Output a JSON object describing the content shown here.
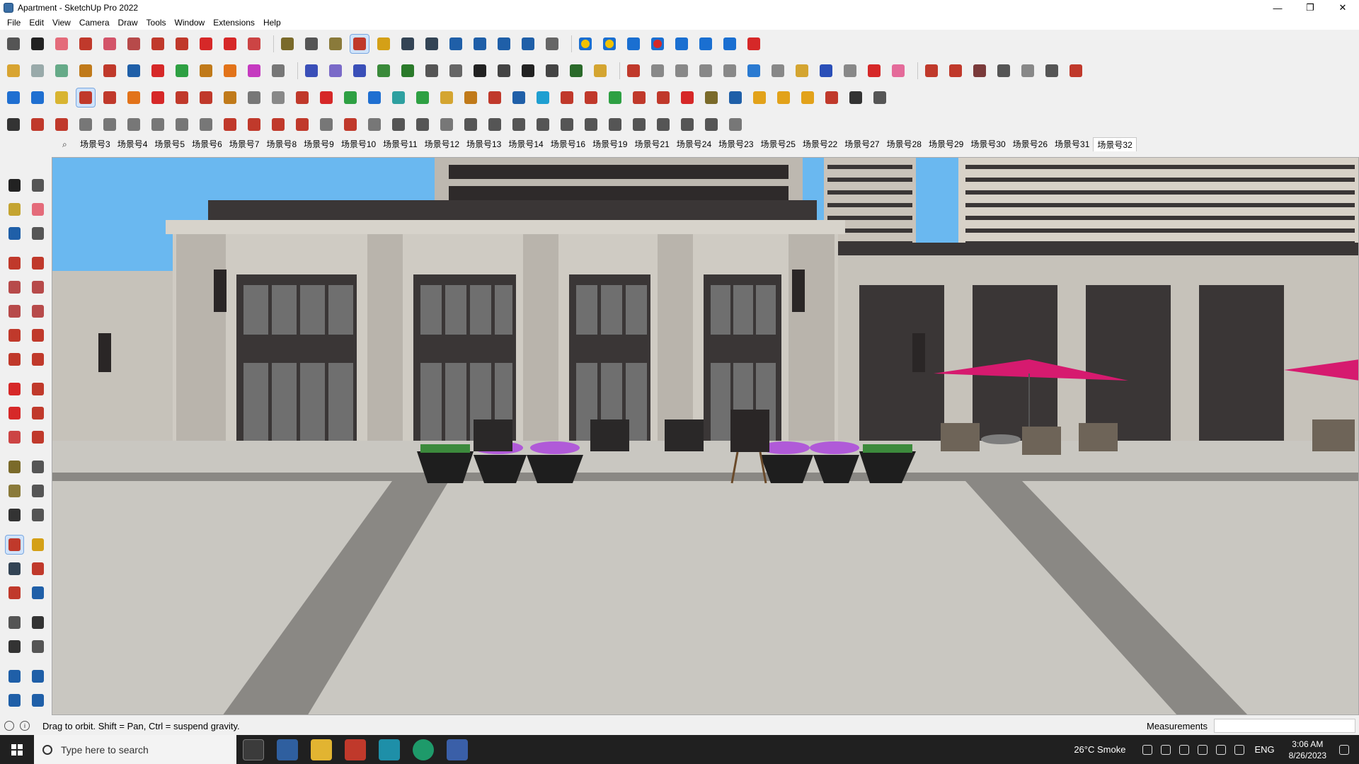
{
  "window": {
    "title": "Apartment - SketchUp Pro 2022",
    "minimize_glyph": "—",
    "restore_glyph": "❐",
    "close_glyph": "✕"
  },
  "menu": [
    "File",
    "Edit",
    "View",
    "Camera",
    "Draw",
    "Tools",
    "Window",
    "Extensions",
    "Help"
  ],
  "scene_tabs": [
    "场景号3",
    "场景号4",
    "场景号5",
    "场景号6",
    "场景号7",
    "场景号8",
    "场景号9",
    "场景号10",
    "场景号11",
    "场景号12",
    "场景号13",
    "场景号14",
    "场景号16",
    "场景号19",
    "场景号21",
    "场景号24",
    "场景号23",
    "场景号25",
    "场景号22",
    "场景号27",
    "场景号28",
    "场景号29",
    "场景号30",
    "场景号26",
    "场景号31",
    "场景号32"
  ],
  "active_scene": "场景号32",
  "status": {
    "hint": "Drag to orbit. Shift = Pan, Ctrl = suspend gravity.",
    "measurements_label": "Measurements",
    "info_glyph": "i"
  },
  "taskbar": {
    "search_placeholder": "Type here to search",
    "weather": "26°C  Smoke",
    "language": "ENG",
    "time": "3:06 AM",
    "date": "8/26/2023"
  },
  "colors": {
    "sky": "#6ab8f0",
    "facade": "#cfcbc3",
    "facade_dark": "#3a3636",
    "ground": "#c9c7c1",
    "umbrella": "#d61a6f",
    "planter_plants": "#b05ad8"
  }
}
